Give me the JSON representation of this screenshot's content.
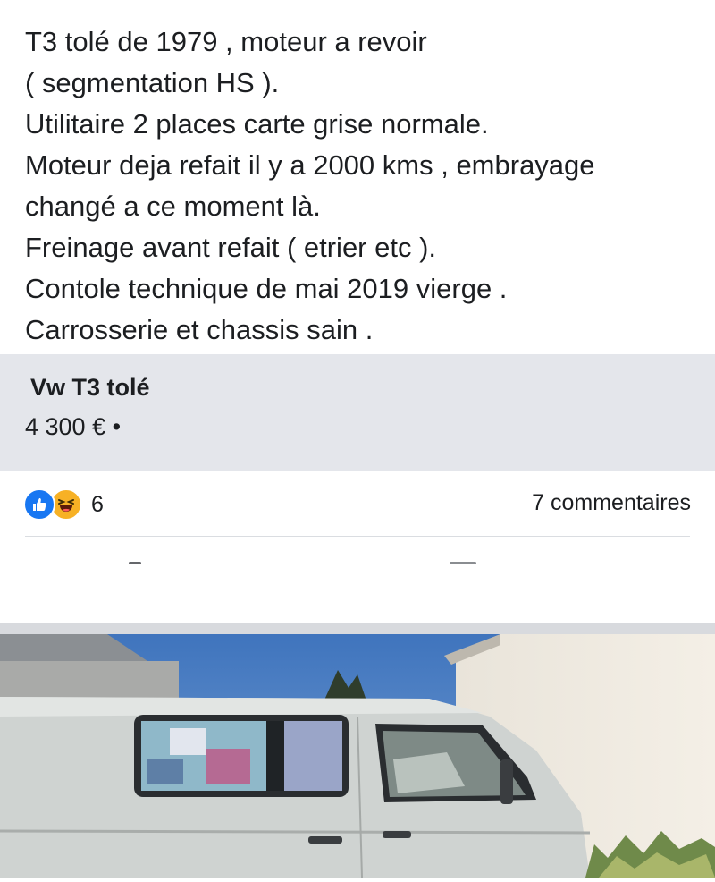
{
  "post": {
    "lines": [
      "T3 tolé de 1979 , moteur a revoir",
      "( segmentation HS ).",
      "Utilitaire 2 places carte grise normale.",
      "Moteur deja refait il y a 2000 kms , embrayage",
      "changé a ce moment là.",
      "Freinage avant refait ( etrier etc ).",
      "Contole technique de mai 2019 vierge .",
      "Carrosserie et chassis sain ."
    ]
  },
  "listing": {
    "title": "Vw T3 tolé",
    "price": "4 300 € •"
  },
  "engagement": {
    "reaction_count": "6",
    "reaction_icons": [
      "like-icon",
      "haha-icon"
    ],
    "comments": "7 commentaires"
  },
  "colors": {
    "like_blue": "#1877f2",
    "haha_yellow": "#f7b125",
    "card_bg": "#e4e6eb",
    "sky": "#4b7fc4",
    "van_body": "#cfd3d1"
  },
  "photo": {
    "subject": "van-photo"
  }
}
